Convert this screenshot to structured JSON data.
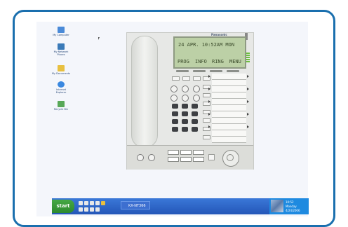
{
  "desktop": {
    "icons": [
      {
        "name": "my-computer-icon",
        "label": "My Computer",
        "color": "#4a8ad8"
      },
      {
        "name": "my-network-places-icon",
        "label": "My Network Places",
        "color": "#3a7ab8"
      },
      {
        "name": "my-documents-icon",
        "label": "My Documents",
        "color": "#e8c040"
      },
      {
        "name": "internet-explorer-icon",
        "label": "Internet Explorer",
        "color": "#3a88e0"
      },
      {
        "name": "recycle-bin-icon",
        "label": "Recycle Bin",
        "color": "#58a858"
      }
    ]
  },
  "phone": {
    "brand": "Panasonic",
    "lcd_line1": "24 APR. 10:52AM  MON",
    "softkeys": [
      "PROG",
      "INFO",
      "RING",
      "MENU"
    ]
  },
  "taskbar": {
    "start_label": "start",
    "task_button": "KX-NT366",
    "tray_line1": "10:52",
    "tray_line2": "Monday",
    "tray_line3": "4/24/2006"
  },
  "colors": {
    "frame": "#1a6fae",
    "taskbar": "#2456b8",
    "lcd": "#bcd0a6",
    "start": "#3a9a3a"
  }
}
